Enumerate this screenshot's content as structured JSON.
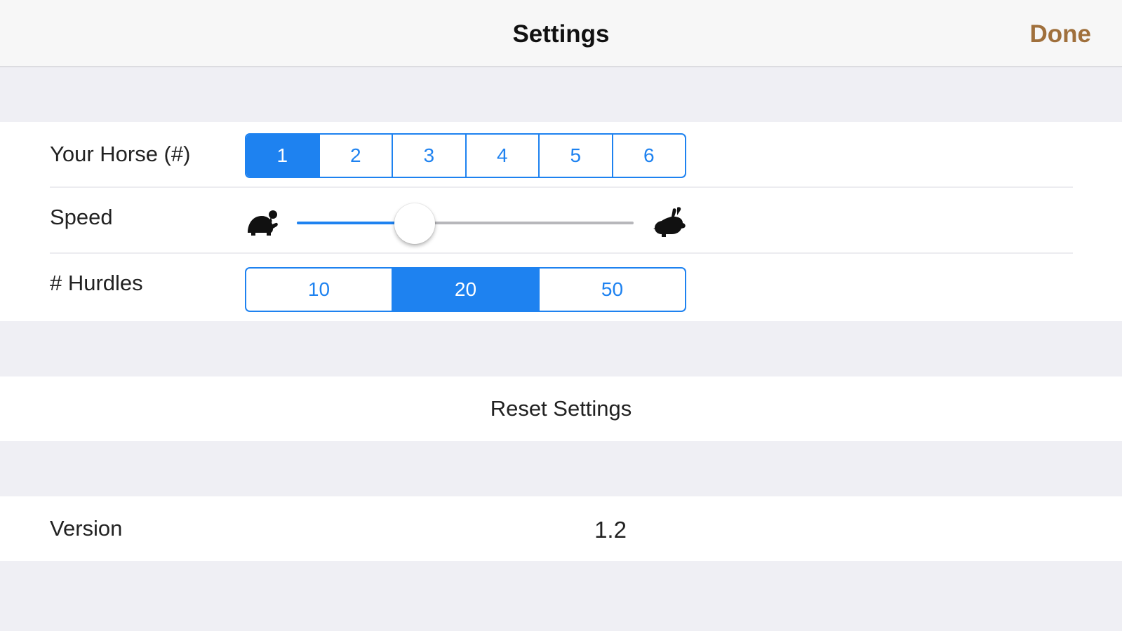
{
  "navbar": {
    "title": "Settings",
    "done_label": "Done",
    "done_color": "#a0703c"
  },
  "settings": {
    "horse": {
      "label": "Your Horse (#)",
      "options": [
        "1",
        "2",
        "3",
        "4",
        "5",
        "6"
      ],
      "selected": "1"
    },
    "speed": {
      "label": "Speed",
      "value_fraction": 0.35,
      "min_icon": "tortoise-icon",
      "max_icon": "hare-icon"
    },
    "hurdles": {
      "label": "# Hurdles",
      "options": [
        "10",
        "20",
        "50"
      ],
      "selected": "20"
    }
  },
  "reset": {
    "label": "Reset Settings"
  },
  "version": {
    "label": "Version",
    "value": "1.2"
  },
  "colors": {
    "accent": "#1e82f0",
    "background": "#efeff4",
    "cell": "#ffffff"
  }
}
